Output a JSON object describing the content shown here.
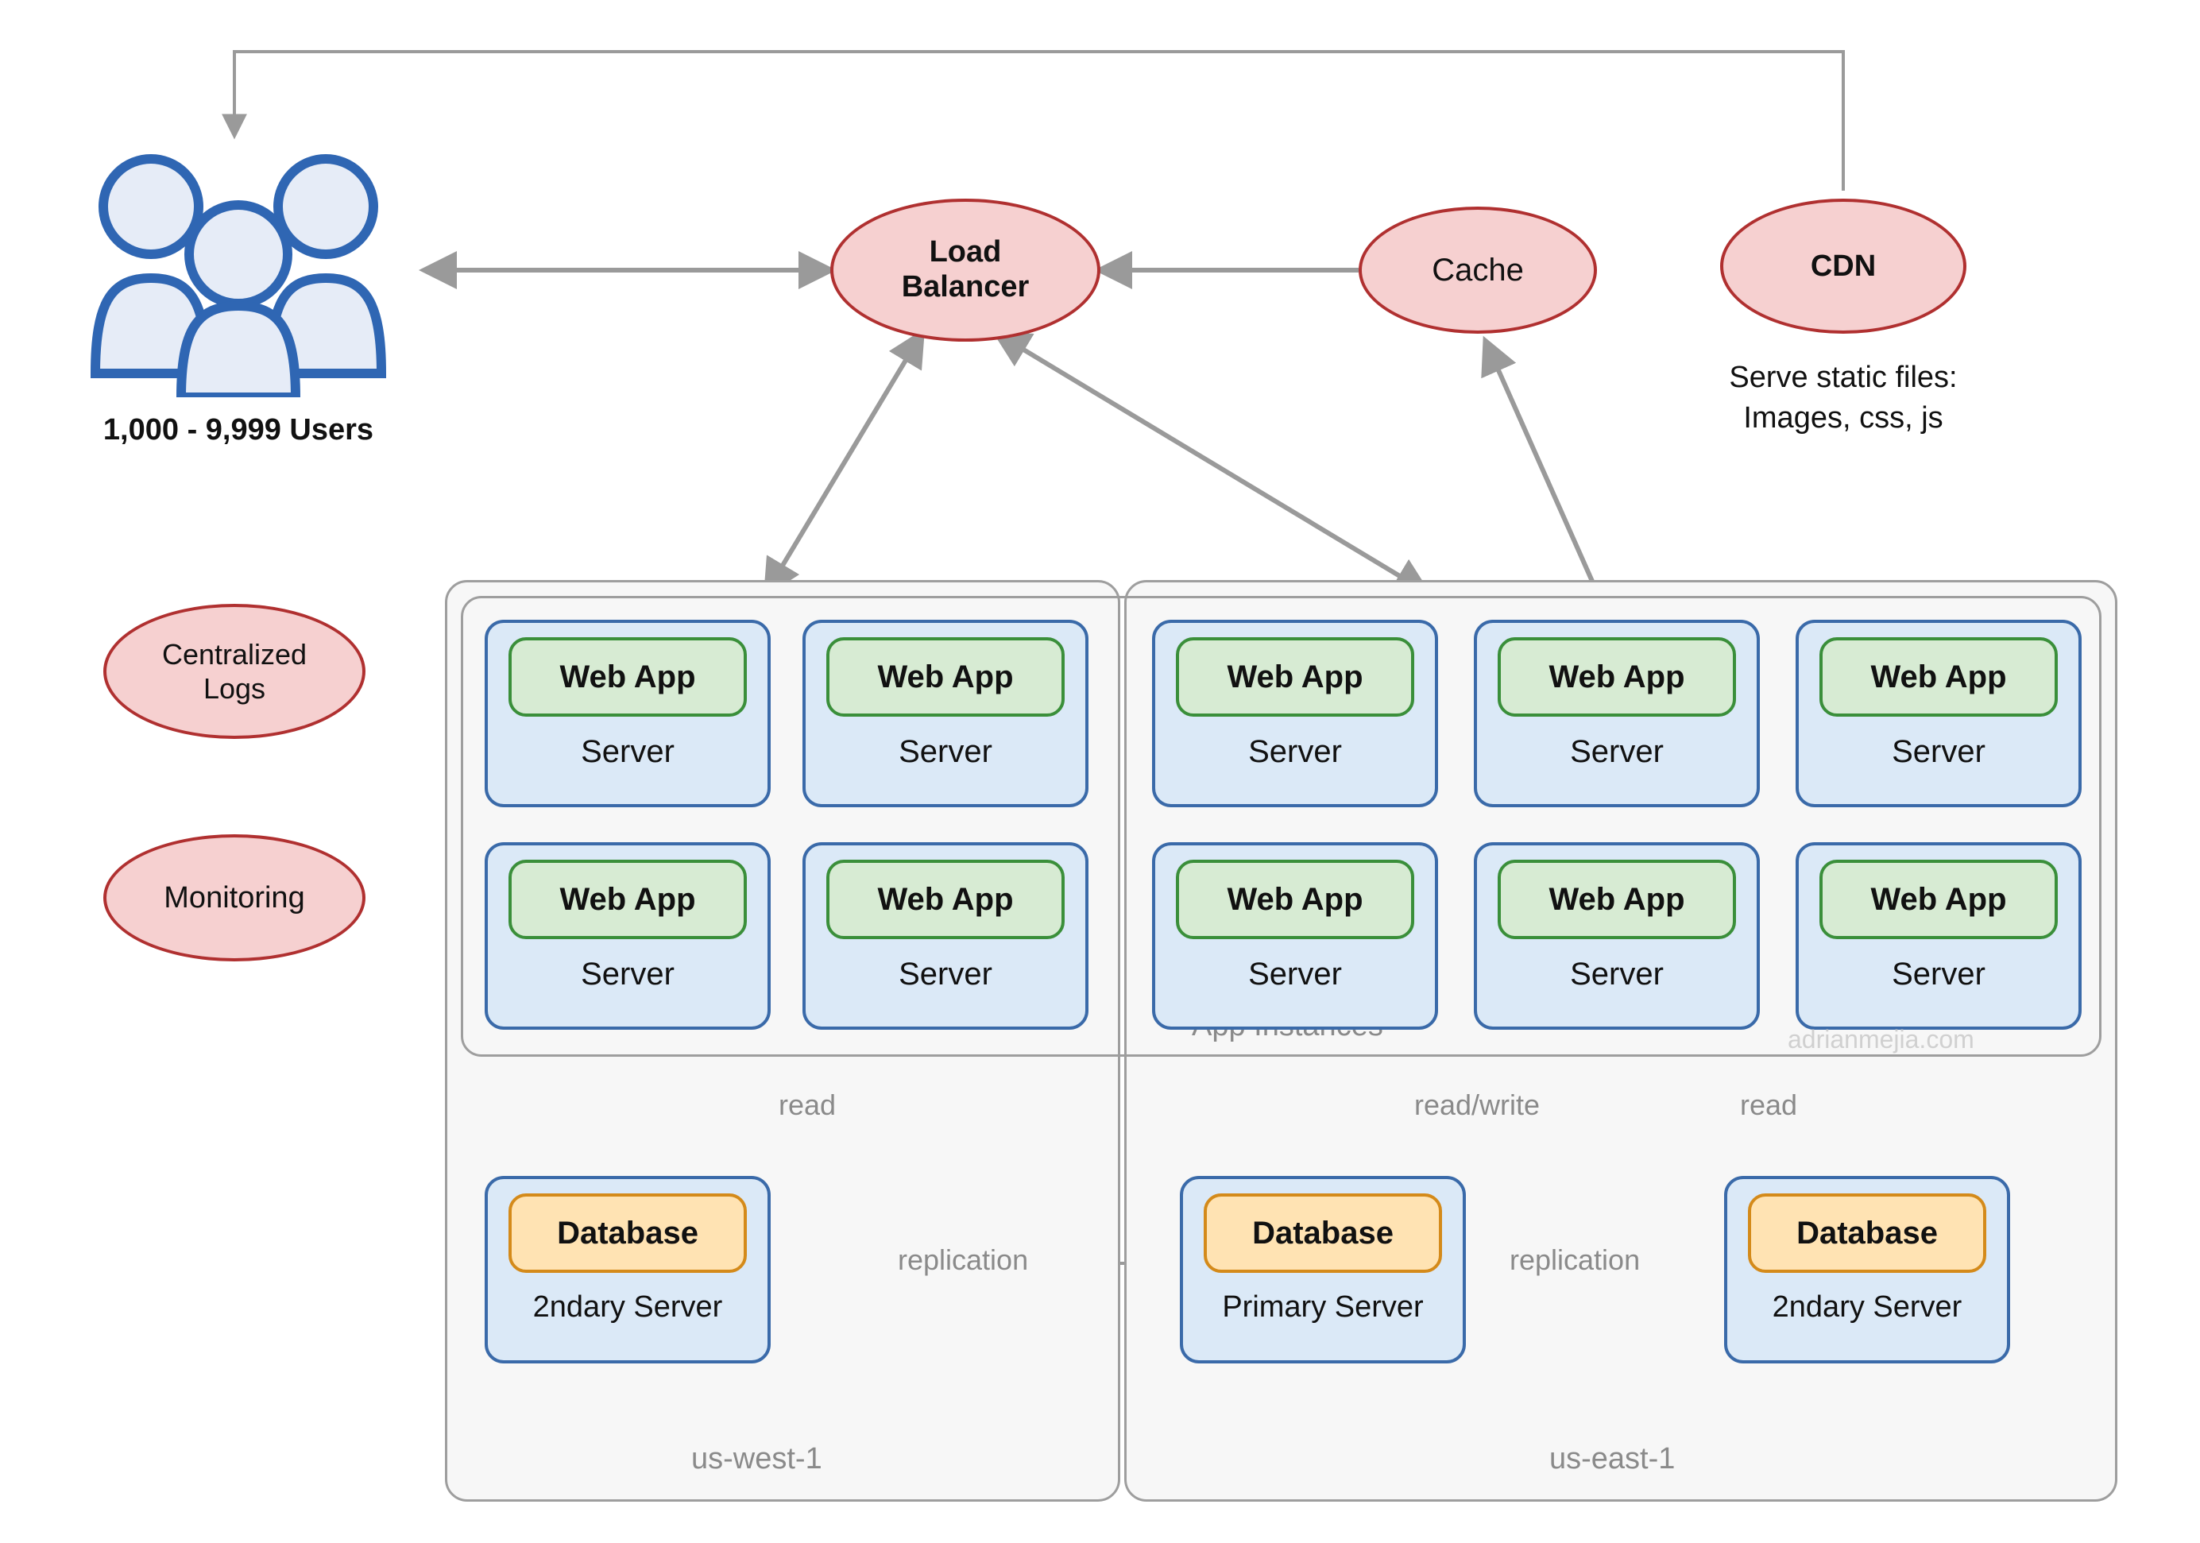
{
  "users": {
    "caption": "1,000 - 9,999 Users"
  },
  "nodes": {
    "load_balancer": "Load Balancer",
    "cache": "Cache",
    "cdn": "CDN",
    "centralized_logs": "Centralized Logs",
    "monitoring": "Monitoring"
  },
  "cdn_caption": "Serve static files:\nImages, css, js",
  "regions": {
    "west": {
      "name": "us-west-1",
      "app_servers": [
        {
          "app": "Web App",
          "server": "Server"
        },
        {
          "app": "Web App",
          "server": "Server"
        },
        {
          "app": "Web App",
          "server": "Server"
        },
        {
          "app": "Web App",
          "server": "Server"
        }
      ],
      "db": {
        "label": "Database",
        "role": "2ndary Server"
      }
    },
    "east": {
      "name": "us-east-1",
      "app_servers": [
        {
          "app": "Web App",
          "server": "Server"
        },
        {
          "app": "Web App",
          "server": "Server"
        },
        {
          "app": "Web App",
          "server": "Server"
        },
        {
          "app": "Web App",
          "server": "Server"
        },
        {
          "app": "Web App",
          "server": "Server"
        },
        {
          "app": "Web App",
          "server": "Server"
        }
      ],
      "db_primary": {
        "label": "Database",
        "role": "Primary Server"
      },
      "db_secondary": {
        "label": "Database",
        "role": "2ndary Server"
      }
    }
  },
  "app_instances_label": "App Instances",
  "edges": {
    "read": "read",
    "read_write": "read/write",
    "replication": "replication"
  },
  "watermark": "adrianmejia.com"
}
